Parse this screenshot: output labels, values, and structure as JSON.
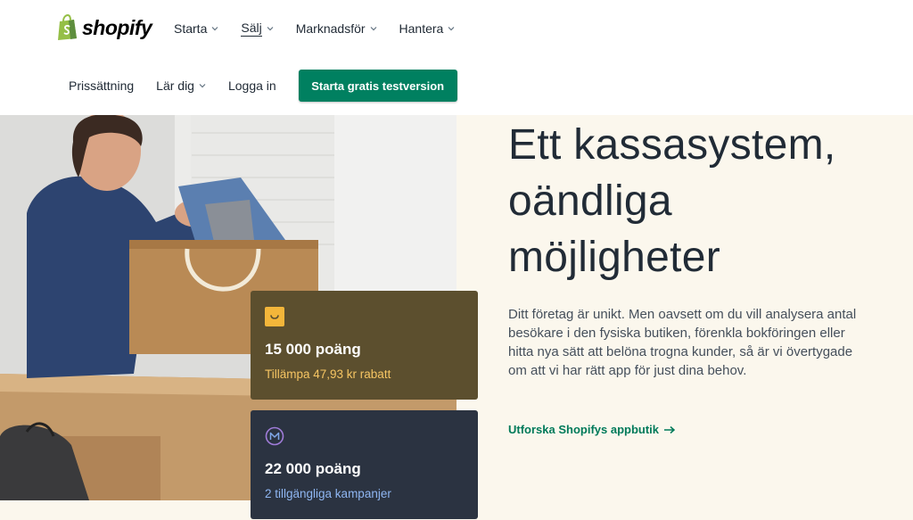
{
  "brand": {
    "name": "shopify"
  },
  "nav": {
    "primary": [
      {
        "label": "Starta",
        "has_dropdown": true,
        "active": false
      },
      {
        "label": "Sälj",
        "has_dropdown": true,
        "active": true
      },
      {
        "label": "Marknadsför",
        "has_dropdown": true,
        "active": false
      },
      {
        "label": "Hantera",
        "has_dropdown": true,
        "active": false
      }
    ],
    "secondary": [
      {
        "label": "Prissättning",
        "has_dropdown": false
      },
      {
        "label": "Lär dig",
        "has_dropdown": true
      },
      {
        "label": "Logga in",
        "has_dropdown": false
      }
    ],
    "cta_label": "Starta gratis testversion"
  },
  "hero": {
    "title": "Ett kassasystem, oändliga möjligheter",
    "body": "Ditt företag är unikt. Men oavsett om du vill analysera antal besökare i den fysiska butiken, förenkla bokföringen eller hitta nya sätt att belöna trogna kunder, så är vi övertygade om att vi har rätt app för just dina behov.",
    "link_label": "Utforska Shopifys appbutik",
    "link_icon": "arrow-right-icon"
  },
  "cards": [
    {
      "icon": "smile-badge-icon",
      "points": "15 000 poäng",
      "subtitle": "Tillämpa 47,93 kr rabatt"
    },
    {
      "icon": "m-circle-icon",
      "points": "22 000 poäng",
      "subtitle": "2 tillgängliga kampanjer"
    }
  ],
  "colors": {
    "accent": "#008060",
    "link": "#007a5a",
    "hero_bg": "#fbf7ed",
    "card1_bg": "#5c4f2e",
    "card1_accent": "#f6c563",
    "card2_bg": "#2b3341",
    "card2_accent": "#8fb6f2"
  }
}
